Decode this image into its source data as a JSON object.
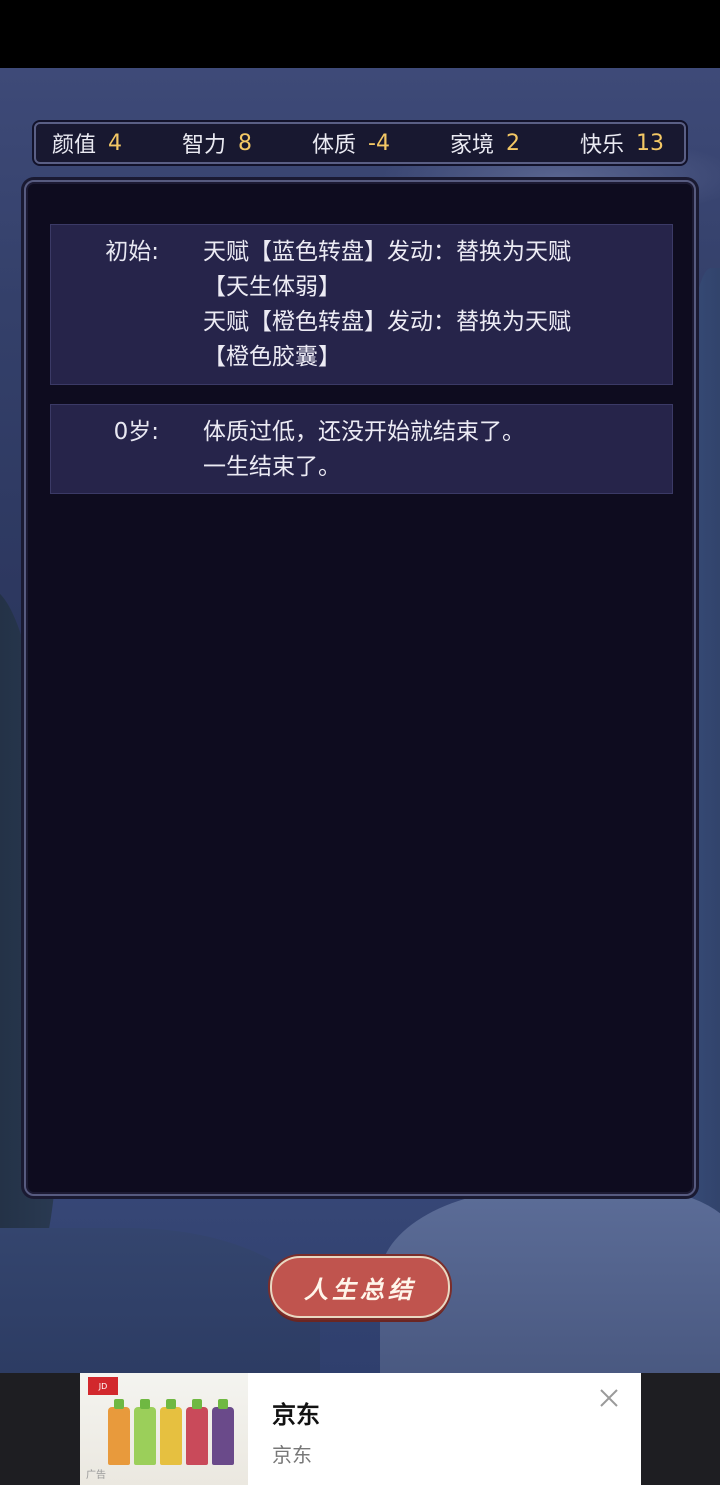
{
  "stats": [
    {
      "label": "颜值",
      "value": "4"
    },
    {
      "label": "智力",
      "value": "8"
    },
    {
      "label": "体质",
      "value": "-4"
    },
    {
      "label": "家境",
      "value": "2"
    },
    {
      "label": "快乐",
      "value": "13"
    }
  ],
  "log": [
    {
      "age": "初始:",
      "lines": [
        "天赋【蓝色转盘】发动：替换为天赋",
        "【天生体弱】",
        "天赋【橙色转盘】发动：替换为天赋",
        "【橙色胶囊】"
      ]
    },
    {
      "age": "0岁:",
      "lines": [
        "体质过低，还没开始就结束了。",
        "一生结束了。"
      ]
    }
  ],
  "summary_button": "人生总结",
  "ad": {
    "title": "京东",
    "subtitle": "京东",
    "ad_mark": "广告",
    "close_icon": "close-icon"
  },
  "colors": {
    "stat_value": "#f4c865",
    "panel_bg": "#0e0c1f",
    "entry_bg": "#26244a",
    "button_bg": "#c0544e"
  }
}
